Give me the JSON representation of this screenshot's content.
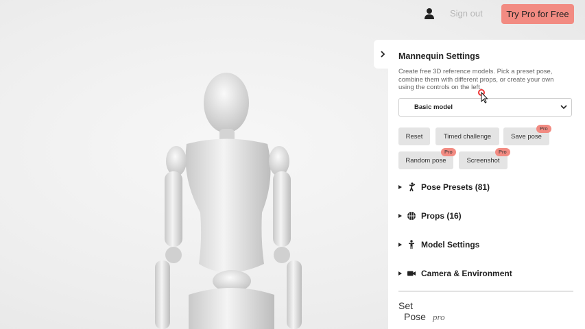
{
  "header": {
    "sign_out_label": "Sign out",
    "try_pro_label": "Try Pro for Free"
  },
  "panel": {
    "title": "Mannequin Settings",
    "description": "Create free 3D reference models. Pick a preset pose, combine them with different props, or create your own using the controls on the left.",
    "model_select_value": "Basic model",
    "buttons": {
      "reset": "Reset",
      "timed_challenge": "Timed challenge",
      "save_pose": "Save pose",
      "random_pose": "Random pose",
      "screenshot": "Screenshot"
    },
    "pro_badge": "Pro",
    "sections": [
      {
        "label": "Pose Presets (81)",
        "icon": "dancer-icon"
      },
      {
        "label": "Props (16)",
        "icon": "basketball-icon"
      },
      {
        "label": "Model Settings",
        "icon": "person-icon"
      },
      {
        "label": "Camera & Environment",
        "icon": "video-camera-icon"
      }
    ],
    "logo_text": "Set Pose",
    "logo_suffix": "pro"
  },
  "colors": {
    "accent": "#f28b82",
    "panel_bg": "#ffffff",
    "button_bg": "#e4e4e4"
  }
}
